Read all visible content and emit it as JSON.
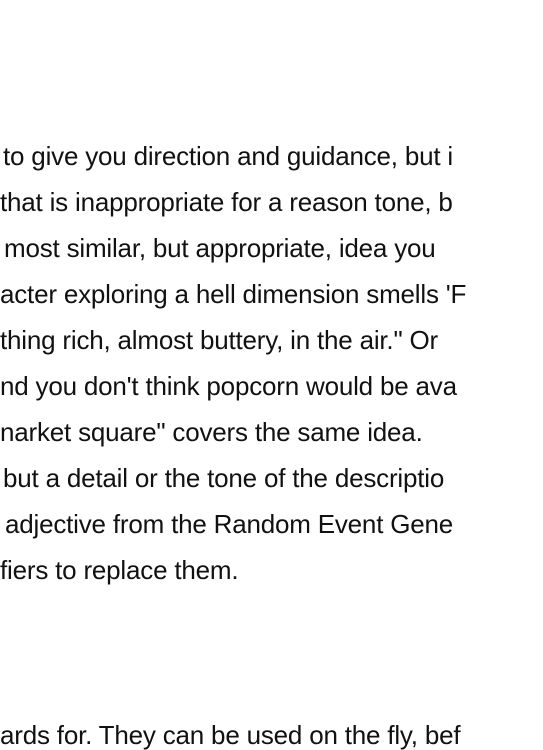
{
  "document": {
    "lines": [
      "to give you direction and guidance, but i",
      "that is inappropriate for a reason tone, b",
      " most similar, but appropriate, idea you",
      "acter exploring a hell dimension smells 'F",
      "thing rich, almost buttery, in the air.\" Or",
      "nd you don't think popcorn would be ava",
      "narket square\" covers the same idea.",
      " but a detail or the tone of the descriptio",
      " adjective from the Random Event Gene",
      "fiers to replace them.",
      "ards for. They can be used on the fly, bef"
    ]
  }
}
